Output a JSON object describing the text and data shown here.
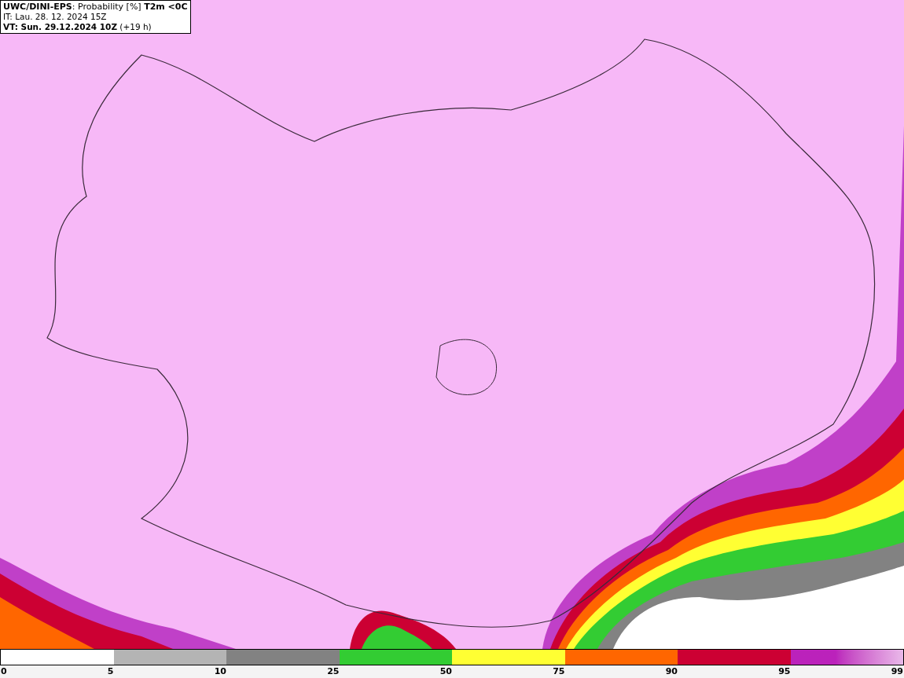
{
  "header": {
    "lines": [
      "**UWC/DINI-EPS**: Probability [%] **T2m <0C**",
      "IT: Lau. 28. 12. 2024 15Z",
      "**VT: Sun. 29.12.2024 10Z** (+19 h)"
    ]
  },
  "legend": {
    "segments": [
      {
        "color": "#ffffff"
      },
      {
        "color": "#b4b4b4"
      },
      {
        "color": "#828282"
      },
      {
        "color": "#33cc33"
      },
      {
        "color": "#ffff33"
      },
      {
        "color": "#ff6600"
      },
      {
        "color": "#cc0033"
      },
      {
        "color": "#bb22bb",
        "kind": "gradient"
      }
    ],
    "ticks": [
      "0",
      "5",
      "10",
      "25",
      "50",
      "75",
      "90",
      "95",
      "99"
    ]
  }
}
